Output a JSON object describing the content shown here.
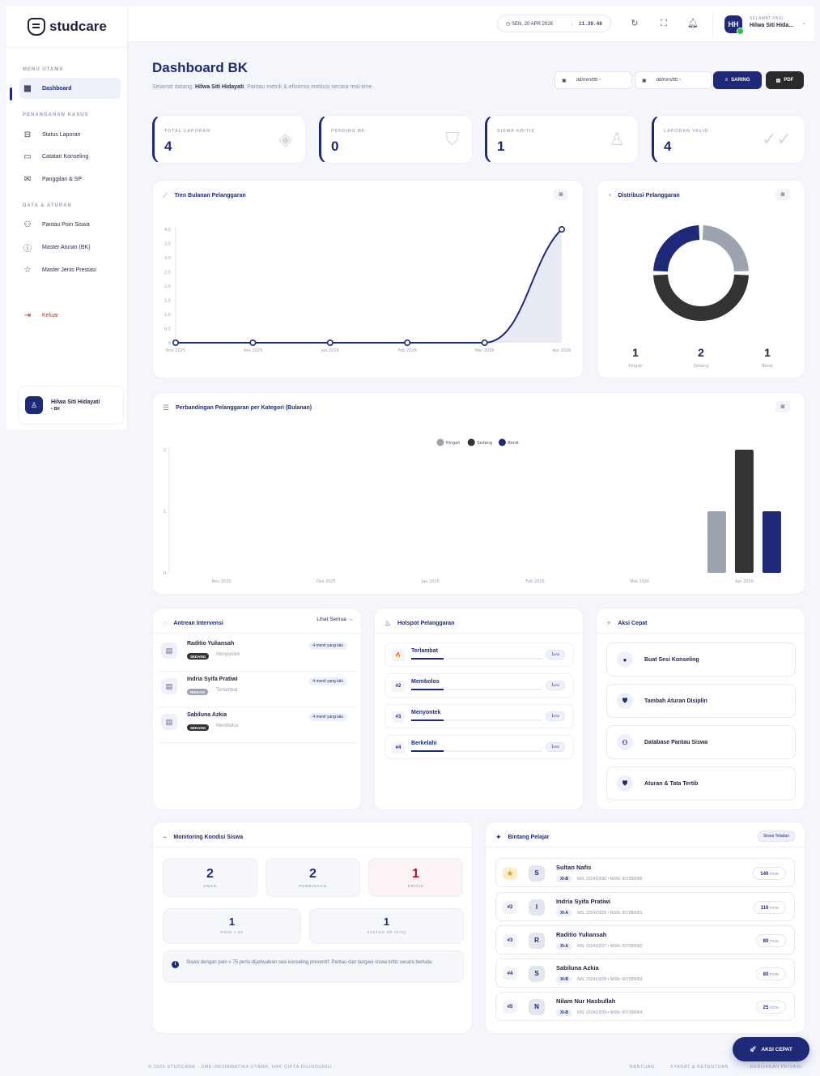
{
  "brand": {
    "name": "studcare"
  },
  "sidebar": {
    "sections": [
      "MENU UTAMA",
      "PENANGANAN KASUS",
      "DATA & ATURAN"
    ],
    "items": [
      {
        "label": "Dashboard",
        "icon": "grid-icon"
      },
      {
        "label": "Status Laporan",
        "icon": "inbox-icon"
      },
      {
        "label": "Catatan Konseling",
        "icon": "chat-icon"
      },
      {
        "label": "Panggilan & SP",
        "icon": "mail-icon"
      },
      {
        "label": "Pantau Poin Siswa",
        "icon": "users-icon"
      },
      {
        "label": "Master Aturan (BK)",
        "icon": "alert-icon"
      },
      {
        "label": "Master Jenis Prestasi",
        "icon": "star-icon"
      }
    ],
    "logout": "Keluar",
    "user": {
      "name": "Hilwa Siti Hidayati",
      "role": "• BK"
    }
  },
  "topbar": {
    "date": "SEN, 20 APR 2026",
    "time": "11.39.48",
    "avatar": "HH",
    "greeting": "SELAMAT PAGI",
    "username": "Hilwa Siti Hida..."
  },
  "header": {
    "title": "Dashboard BK",
    "sub_pre": "Selamat datang, ",
    "sub_name": "Hilwa Siti Hidayati",
    "sub_post": ". Pantau metrik & efisiensi institusi secara real-time.",
    "date_from": "dd/mm/tttt",
    "date_to": "dd/mm/tttt",
    "filter_label": "SARING",
    "pdf_label": "PDF"
  },
  "stats": [
    {
      "label": "TOTAL LAPORAN",
      "value": "4"
    },
    {
      "label": "PENDING BK",
      "value": "0"
    },
    {
      "label": "SISWA KRITIS",
      "value": "1"
    },
    {
      "label": "LAPORAN VALID",
      "value": "4"
    }
  ],
  "trend": {
    "title": "Tren Bulanan Pelanggaran"
  },
  "distribution": {
    "title": "Distribusi Pelanggaran"
  },
  "comparison": {
    "title": "Perbandingan Pelanggaran per Kategori (Bulanan)"
  },
  "chart_data": [
    {
      "type": "area",
      "title": "Tren Bulanan Pelanggaran",
      "x": [
        "Nov 2025",
        "Des 2025",
        "Jan 2026",
        "Feb 2026",
        "Mar 2026",
        "Apr 2026"
      ],
      "y": [
        0,
        0,
        0,
        0,
        0,
        4
      ],
      "yticks": [
        "0",
        "0,5",
        "1,0",
        "1,5",
        "2,0",
        "2,5",
        "3,0",
        "3,5",
        "4,0"
      ],
      "ylim": [
        0,
        4
      ],
      "color": "#1e2a78"
    },
    {
      "type": "pie",
      "title": "Distribusi Pelanggaran",
      "labels": [
        "Ringan",
        "Sedang",
        "Berat"
      ],
      "values": [
        1,
        2,
        1
      ],
      "colors": [
        "#9ea3b0",
        "#333333",
        "#1e2a78"
      ]
    },
    {
      "type": "bar",
      "title": "Perbandingan Pelanggaran per Kategori (Bulanan)",
      "categories": [
        "Nov 2025",
        "Des 2025",
        "Jan 2026",
        "Feb 2026",
        "Mar 2026",
        "Apr 2026"
      ],
      "yticks": [
        "0",
        "1",
        "2"
      ],
      "ylim": [
        0,
        2
      ],
      "legend": "top",
      "series": [
        {
          "name": "Ringan",
          "color": "#9ea3b0",
          "values": [
            0,
            0,
            0,
            0,
            0,
            1
          ]
        },
        {
          "name": "Sedang",
          "color": "#333333",
          "values": [
            0,
            0,
            0,
            0,
            0,
            2
          ]
        },
        {
          "name": "Berat",
          "color": "#1e2a78",
          "values": [
            0,
            0,
            0,
            0,
            0,
            1
          ]
        }
      ]
    }
  ],
  "queue": {
    "title": "Antrean Intervensi",
    "see_all": "Lihat Semua →",
    "items": [
      {
        "name": "Raditio Yuliansah",
        "badge": "SEDANG",
        "type": "Menyontek",
        "time": "4 menit yang lalu",
        "badge_color": "#333333"
      },
      {
        "name": "Indria Syifa Pratiwi",
        "badge": "RINGAN",
        "type": "Terlambat",
        "time": "4 menit yang lalu",
        "badge_color": "#9ea3b0"
      },
      {
        "name": "Sabiluna Azkia",
        "badge": "SEDANG",
        "type": "Membolos",
        "time": "4 menit yang lalu",
        "badge_color": "#333333"
      }
    ]
  },
  "hotspot": {
    "title": "Hotspot Pelanggaran",
    "items": [
      {
        "rank": "🔥",
        "name": "Terlambat",
        "count": "1",
        "unit": "KSS"
      },
      {
        "rank": "#2",
        "name": "Membolos",
        "count": "1",
        "unit": "KSS"
      },
      {
        "rank": "#3",
        "name": "Menyontek",
        "count": "1",
        "unit": "KSS"
      },
      {
        "rank": "#4",
        "name": "Berkelahi",
        "count": "1",
        "unit": "KSS"
      }
    ]
  },
  "quick": {
    "title": "Aksi Cepat",
    "items": [
      {
        "label": "Buat Sesi Konseling"
      },
      {
        "label": "Tambah Aturan Disiplin"
      },
      {
        "label": "Database Pantau Siswa"
      },
      {
        "label": "Aturan & Tata Tertib"
      }
    ]
  },
  "monitoring": {
    "title": "Monitoring Kondisi Siswa",
    "aman": {
      "value": "2",
      "label": "AMAN"
    },
    "pembinaan": {
      "value": "2",
      "label": "PEMBINAAN"
    },
    "kritis": {
      "value": "1",
      "label": "KRITIS"
    },
    "poin": {
      "value": "1",
      "label": "POIN < 50"
    },
    "status_sp": {
      "value": "1",
      "label": "STATUS SP (≤75)"
    },
    "info": "Siswa dengan poin ≤ 75 perlu dijadwalkan sesi konseling preventif. Pantau dan tangani siswa kritis secara berkala."
  },
  "stars": {
    "title": "Bintang Pelajar",
    "badge": "Siswa Teladan",
    "items": [
      {
        "rank": "★",
        "initial": "S",
        "name": "Sultan Nafis",
        "cls": "XI-B",
        "ids": "NIS: 232410030 • NISN: 007399065",
        "points": "140",
        "unit": "POIN"
      },
      {
        "rank": "#2",
        "initial": "I",
        "name": "Indria Syifa Pratiwi",
        "cls": "XI-A",
        "ids": "NIS: 232410026 • NISN: 007399061",
        "points": "110",
        "unit": "POIN"
      },
      {
        "rank": "#3",
        "initial": "R",
        "name": "Raditio Yuliansah",
        "cls": "XI-A",
        "ids": "NIS: 232410027 • NISN: 007399062",
        "points": "80",
        "unit": "POIN"
      },
      {
        "rank": "#4",
        "initial": "S",
        "name": "Sabiluna Azkia",
        "cls": "XI-B",
        "ids": "NIS: 232410028 • NISN: 007399063",
        "points": "80",
        "unit": "POIN"
      },
      {
        "rank": "#5",
        "initial": "N",
        "name": "Nilam Nur Hasbullah",
        "cls": "XI-B",
        "ids": "NIS: 232410029 • NISN: 007399064",
        "points": "25",
        "unit": "POIN"
      }
    ]
  },
  "footer": {
    "copyright": "© 2026 STUDCARE - SMK INFORMATIKA UTAMA. HAK CIPTA DILINDUNGI.",
    "links": [
      "BANTUAN",
      "SYARAT & KETENTUAN",
      "KEBIJAKAN PRIVASI"
    ]
  },
  "fab": {
    "label": "AKSI CEPAT"
  }
}
